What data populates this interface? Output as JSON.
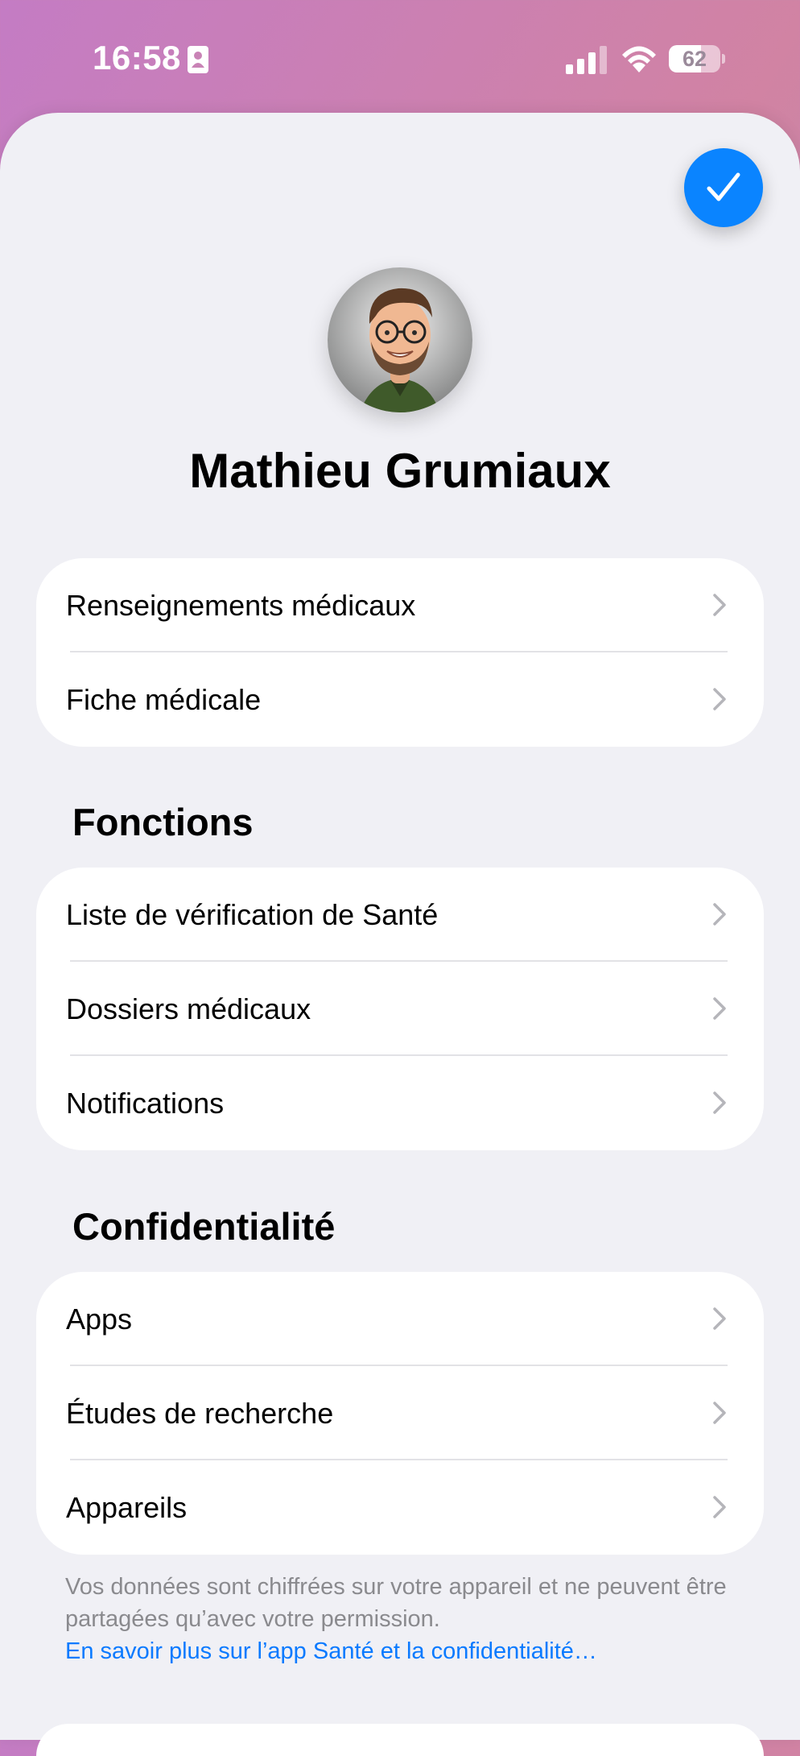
{
  "status_bar": {
    "time": "16:58",
    "battery_percent": "62",
    "battery_level": 0.62,
    "icons": [
      "contact-card-icon",
      "cellular-signal-icon",
      "wifi-icon",
      "battery-icon"
    ]
  },
  "header": {
    "done_icon": "checkmark-icon",
    "accent_color": "#0a84ff",
    "profile_name": "Mathieu Grumiaux"
  },
  "medical_group": {
    "items": [
      {
        "label": "Renseignements médicaux"
      },
      {
        "label": "Fiche médicale"
      }
    ]
  },
  "features": {
    "title": "Fonctions",
    "items": [
      {
        "label": "Liste de vérification de Santé"
      },
      {
        "label": "Dossiers médicaux"
      },
      {
        "label": "Notifications"
      }
    ]
  },
  "privacy": {
    "title": "Confidentialité",
    "items": [
      {
        "label": "Apps"
      },
      {
        "label": "Études de recherche"
      },
      {
        "label": "Appareils"
      }
    ],
    "footnote": "Vos données sont chiffrées sur votre appareil et ne peuvent être partagées qu’avec votre permission.",
    "link": "En savoir plus sur l’app Santé et la confidentialité…"
  }
}
